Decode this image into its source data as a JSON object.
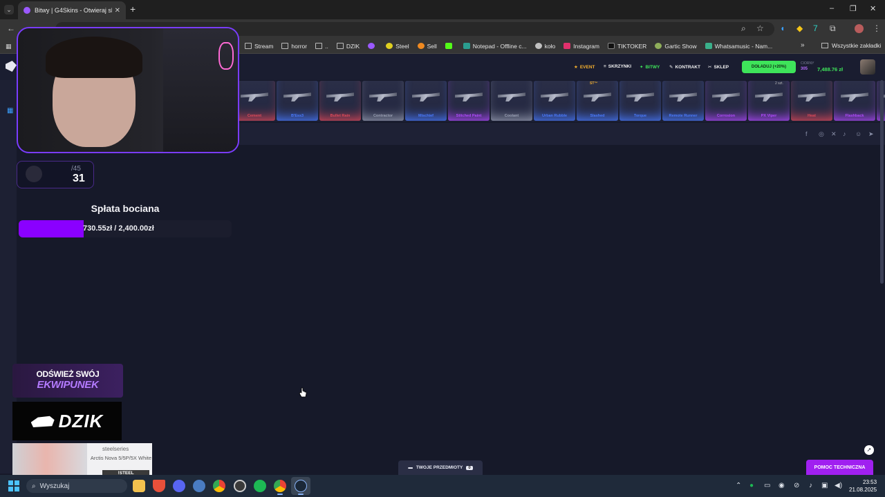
{
  "browser": {
    "tab_title": "Bitwy | G4Skins - Otwieraj skrz...",
    "bookmarks": [
      "Stream",
      "horror",
      "..",
      "DZIK",
      "",
      "Steel",
      "Sell",
      "",
      "Notepad - Offline c...",
      "koło",
      "Instagram",
      "TIKTOKER",
      "Gartic Show",
      "Whatsamusic - Nam..."
    ],
    "all_bookmarks": "Wszystkie zakładki"
  },
  "site": {
    "nav": [
      "EVENT",
      "SKRZYNKI",
      "BITWY",
      "KONTRAKT",
      "SKLEP"
    ],
    "topup_label": "DOŁADUJ (+20%)",
    "balance_label": "CIORNY",
    "balance_coins": "305",
    "balance_zl": "7,488.76 zł",
    "drops": [
      {
        "name": "Cement",
        "color": "#e04a5a"
      },
      {
        "name": "B'Ess3",
        "color": "#4a7bff"
      },
      {
        "name": "Bullet Rain",
        "color": "#e04a5a"
      },
      {
        "name": "Contractor",
        "color": "#9aa0b4"
      },
      {
        "name": "Mischief",
        "color": "#4a7bff"
      },
      {
        "name": "Stitched Paint",
        "color": "#b24aff"
      },
      {
        "name": "Coolant",
        "color": "#9aa0b4"
      },
      {
        "name": "Urban Rubble",
        "color": "#4a7bff"
      },
      {
        "name": "Slashed",
        "color": "#4a7bff"
      },
      {
        "name": "Torque",
        "color": "#4a7bff"
      },
      {
        "name": "Remote Runner",
        "color": "#4a7bff"
      },
      {
        "name": "Corrosion",
        "color": "#b24aff"
      },
      {
        "name": "PX Viper",
        "color": "#b24aff"
      },
      {
        "name": "Heat",
        "color": "#e04a5a"
      },
      {
        "name": "Flashback",
        "color": "#b24aff"
      },
      {
        "name": "Violent D",
        "color": "#b24aff"
      }
    ],
    "drop_badges": {
      "st": "ST™",
      "qty": "2 szt."
    },
    "items_button": "TWOJE PRZEDMIOTY",
    "items_count": "0",
    "help_button": "POMOC TECHNICZNA"
  },
  "overlay": {
    "counter_total": "/45",
    "counter_current": "31",
    "goal_title": "Spłata bociana",
    "goal_text": "730.55zł / 2,400.00zł",
    "goal_progress": 0.304,
    "promo1_line1": "ODŚWIEŻ SWÓJ",
    "promo1_line2": "EKWIPUNEK",
    "promo2_text": "DZIK",
    "promo3_brand": "steelseries",
    "promo3_product": "Arctis Nova 5/5P/5X White",
    "promo3_code": "!STEEL"
  },
  "taskbar": {
    "search_placeholder": "Wyszukaj",
    "time": "23:53",
    "date": "21.08.2025"
  }
}
